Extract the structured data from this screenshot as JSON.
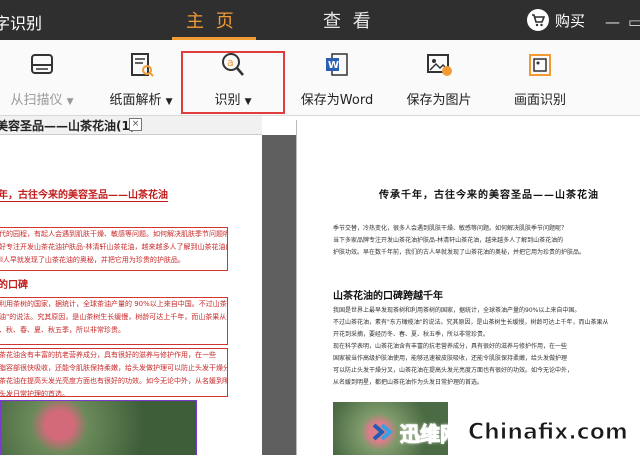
{
  "app": {
    "title": "字识别"
  },
  "tabs": [
    {
      "label": "主 页"
    },
    {
      "label": "查 看"
    }
  ],
  "buy": {
    "label": "购买"
  },
  "window_controls": {
    "minimize": "—",
    "restore": "▭"
  },
  "toolbar": {
    "scan_label": "从扫描仪",
    "layout_label": "纸面解析",
    "recognize_label": "识别",
    "save_word_label": "保存为Word",
    "save_image_label": "保存为图片",
    "screen_ocr_label": "画面识别",
    "dropdown_glyph": "▼"
  },
  "document_tab": {
    "label": "美容圣品——山茶花油(1)",
    "close_glyph": "×"
  },
  "left_document": {
    "title": "年，古往今来的美容圣品——山茶花油",
    "para1": [
      "代的园程，有起人会遇到肌肤干燥、敏感等问题。如何解决肌肤季节问题呢？",
      "好专注开发山茶花油护肤品-林清轩山茶花油，越来越多人了解到山茶花油的",
      "ll人早就发现了山茶花油的奥秘，并把它用为珍贵的护肤品。"
    ],
    "heading": "的口碑",
    "para2": [
      "利用茶树的国家，据统计，全球茶油产量的 90%以上来自中国。不过山茶花",
      "油\"的说法。究其原因，是山茶树生长缓慢，树龄可达上千年，而山茶果从开",
      "、秋、春、夏、秋五季，所以非常珍贵。",
      "茶花油含有丰富的抗老营养成分，具有很好的滋养与修护作用，在一些",
      "脂容部很快吸收，还能令肌肤保持柔嫩，给头发做护理可以防止头发干燥分叉",
      "茶花油在提高头发光亮度方面也有很好的功效。如今无论中外，从名媛到明星",
      "头发日常护理的首选。"
    ]
  },
  "right_document": {
    "title": "传承千年，古往今来的美容圣品——山茶花油",
    "para1": [
      "季节交替，冷热变化，很多人会遇到肌肤干燥、敏感等问题。如何解决肌肤季节问题呢？",
      "当下多家品牌专注开发山茶花油护肤品-林清轩山茶花油，越来越多人了解到山茶花油的",
      "护肤功效。早在数千年前，我们的古人早就发现了山茶花油的奥秘，并把它用为珍贵的护肤品。"
    ],
    "heading": "山茶花油的口碑跨越千年",
    "para2": [
      "我国是世界上最早发现茶树和利用茶树的国家，据统计，全球茶油产量的90%以上来自中国。",
      "不过山茶花油，素有\"东方橄榄油\"的说法。究其原因，是山茶树生长缓慢，树龄可达上千年，而山茶果从",
      "开花到采摘，要经历冬、春、夏、秋五季，所以非常珍贵。",
      "现在科学表明，山茶花油含有丰富的抗老营养成分，具有很好的滋养与修护作用，在一些",
      "国家被当作高级护肤油使用，能够迅速被皮肤吸收，还能令肌肤保持柔嫩，给头发做护理",
      "可以防止头发干燥分叉，山茶花油在提高头发光亮度方面也有很好的功效。如今无论中外，",
      "从名媛到明星，都把山茶花油作为头发日常护理的首选。"
    ]
  },
  "watermark": {
    "brand_cn": "迅维网",
    "brand_en": "Chinafix.com"
  },
  "colors": {
    "accent": "#f29a34",
    "topbar": "#2f2f2f",
    "highlight": "#e23d3d",
    "ocr_box": "#d2342f"
  }
}
